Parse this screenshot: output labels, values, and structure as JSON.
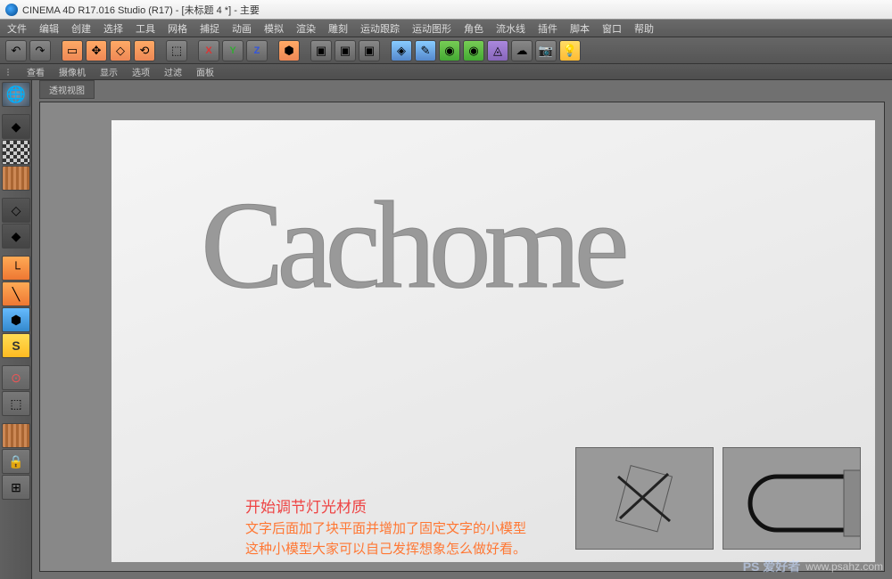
{
  "title": "CINEMA 4D R17.016 Studio (R17) - [未标题 4 *] - 主要",
  "menu": [
    "文件",
    "编辑",
    "创建",
    "选择",
    "工具",
    "网格",
    "捕捉",
    "动画",
    "模拟",
    "渲染",
    "雕刻",
    "运动跟踪",
    "运动图形",
    "角色",
    "流水线",
    "插件",
    "脚本",
    "窗口",
    "帮助"
  ],
  "submenu": [
    "查看",
    "摄像机",
    "显示",
    "选项",
    "过滤",
    "面板"
  ],
  "axes": {
    "x": "X",
    "y": "Y",
    "z": "Z"
  },
  "viewport_tab": "透视视图",
  "content": {
    "text3d": "Cachome",
    "line1": "开始调节灯光材质",
    "line2": "文字后面加了块平面并增加了固定文字的小模型\n这种小模型大家可以自己发挥想象怎么做好看。"
  },
  "watermark": {
    "brand": "PS 爱好者",
    "url": "www.psahz.com"
  }
}
